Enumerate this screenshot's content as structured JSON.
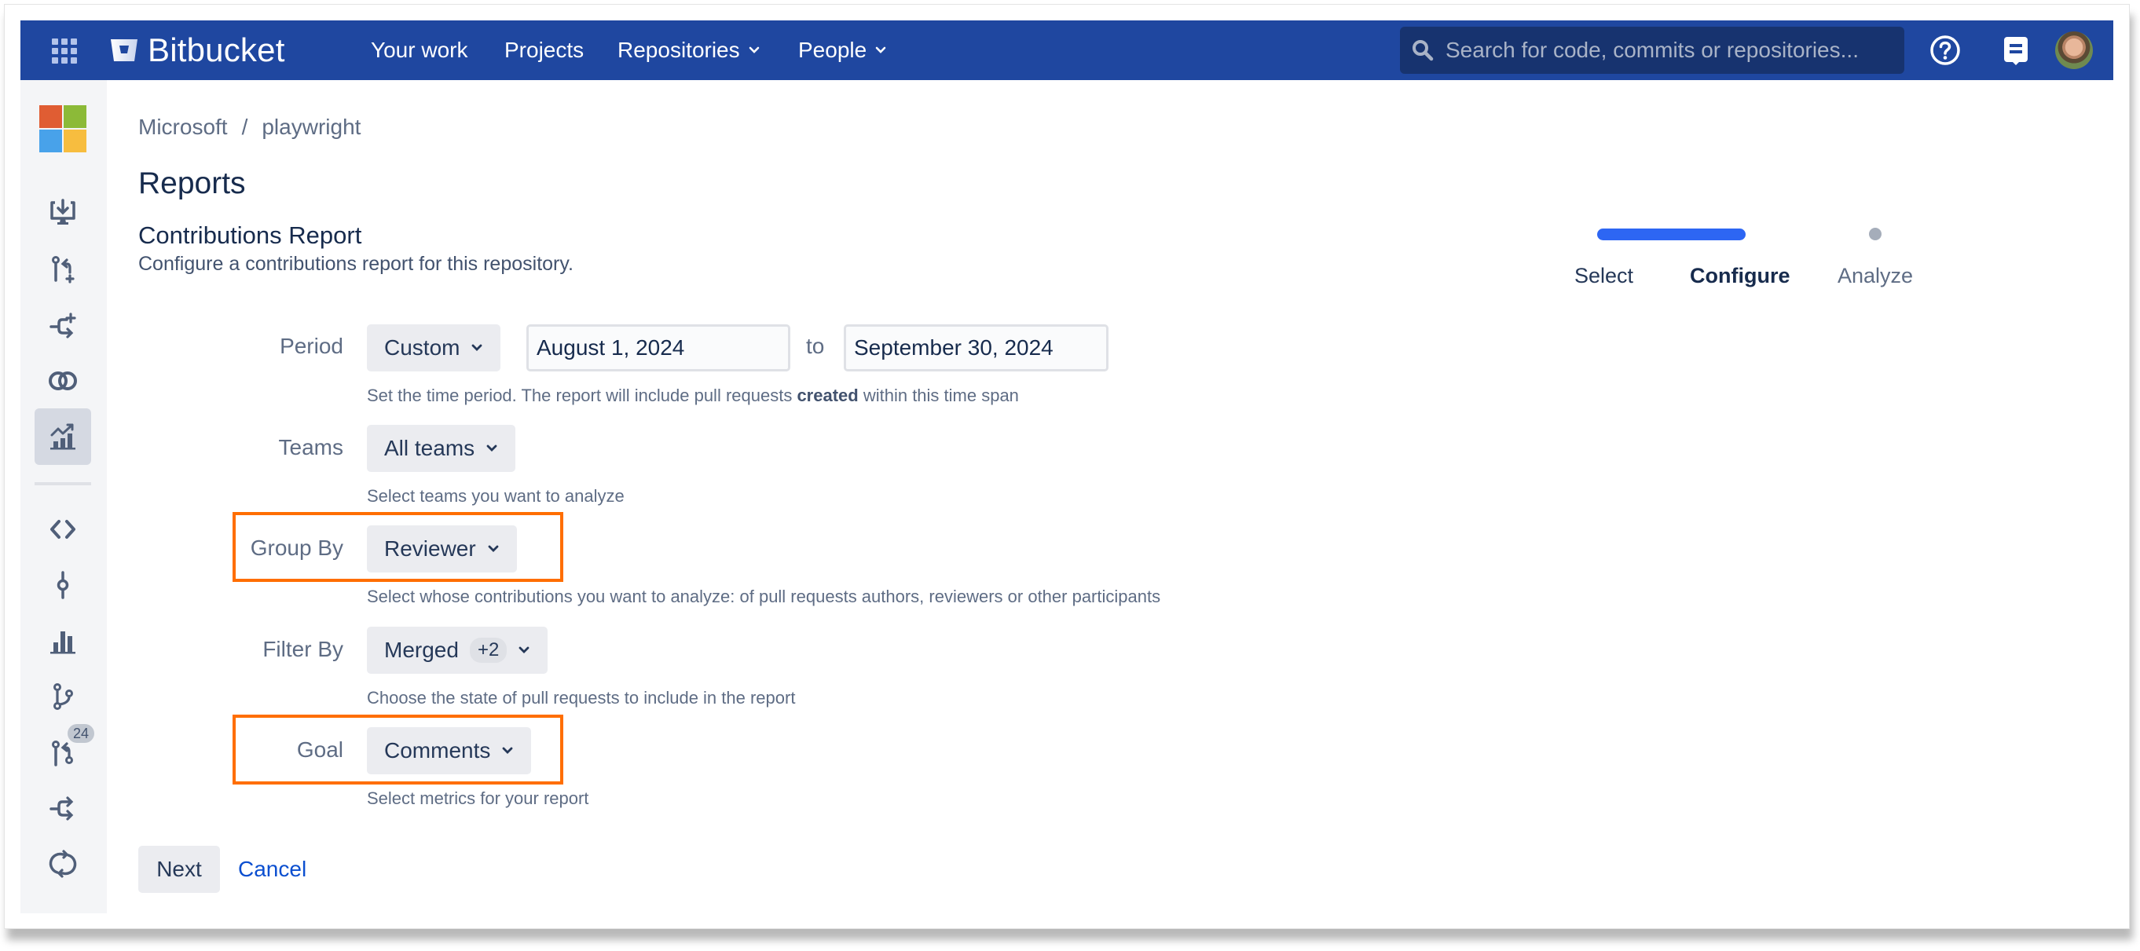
{
  "topbar": {
    "brand": "Bitbucket",
    "nav": [
      {
        "label": "Your work",
        "has_dropdown": false
      },
      {
        "label": "Projects",
        "has_dropdown": false
      },
      {
        "label": "Repositories",
        "has_dropdown": true
      },
      {
        "label": "People",
        "has_dropdown": true
      }
    ],
    "search_placeholder": "Search for code, commits or repositories...",
    "icons": [
      "app-switcher-icon",
      "help-icon",
      "notes-icon",
      "user-avatar"
    ],
    "color": "#1f47a0"
  },
  "sidebar": {
    "project_logo": "microsoft-logo",
    "items": [
      {
        "name": "clone-icon",
        "active": false
      },
      {
        "name": "create-pull-request-icon",
        "active": false
      },
      {
        "name": "create-branch-icon",
        "active": false
      },
      {
        "name": "compare-icon",
        "active": false
      },
      {
        "name": "reports-icon",
        "active": true
      },
      {
        "name": "source-icon",
        "active": false
      },
      {
        "name": "commits-icon",
        "active": false
      },
      {
        "name": "insights-icon",
        "active": false
      },
      {
        "name": "branches-icon",
        "active": false
      },
      {
        "name": "pull-requests-icon",
        "active": false,
        "badge": "24"
      },
      {
        "name": "forks-icon",
        "active": false
      },
      {
        "name": "sync-icon",
        "active": false
      }
    ]
  },
  "breadcrumb": {
    "project": "Microsoft",
    "separator": "/",
    "repo": "playwright"
  },
  "page": {
    "title": "Reports",
    "section_title": "Contributions Report",
    "section_description": "Configure a contributions report for this repository."
  },
  "stepper": {
    "steps": [
      {
        "label": "Select",
        "state": "done"
      },
      {
        "label": "Configure",
        "state": "current"
      },
      {
        "label": "Analyze",
        "state": "pending"
      }
    ],
    "accent": "#2d66f3"
  },
  "form": {
    "period": {
      "label": "Period",
      "value": "Custom",
      "from": "August 1, 2024",
      "to_label": "to",
      "to": "September 30, 2024",
      "hint_before": "Set the time period. The report will include pull requests ",
      "hint_bold": "created",
      "hint_after": " within this time span"
    },
    "teams": {
      "label": "Teams",
      "value": "All teams",
      "hint": "Select teams you want to analyze"
    },
    "group_by": {
      "label": "Group By",
      "value": "Reviewer",
      "hint": "Select whose contributions you want to analyze: of pull requests authors, reviewers or other participants",
      "highlighted": true
    },
    "filter_by": {
      "label": "Filter By",
      "value": "Merged",
      "extra_count": "+2",
      "hint": "Choose the state of pull requests to include in the report"
    },
    "goal": {
      "label": "Goal",
      "value": "Comments",
      "hint": "Select metrics for your report",
      "highlighted": true
    },
    "highlight_color": "#ff6e00"
  },
  "actions": {
    "next": "Next",
    "cancel": "Cancel"
  }
}
